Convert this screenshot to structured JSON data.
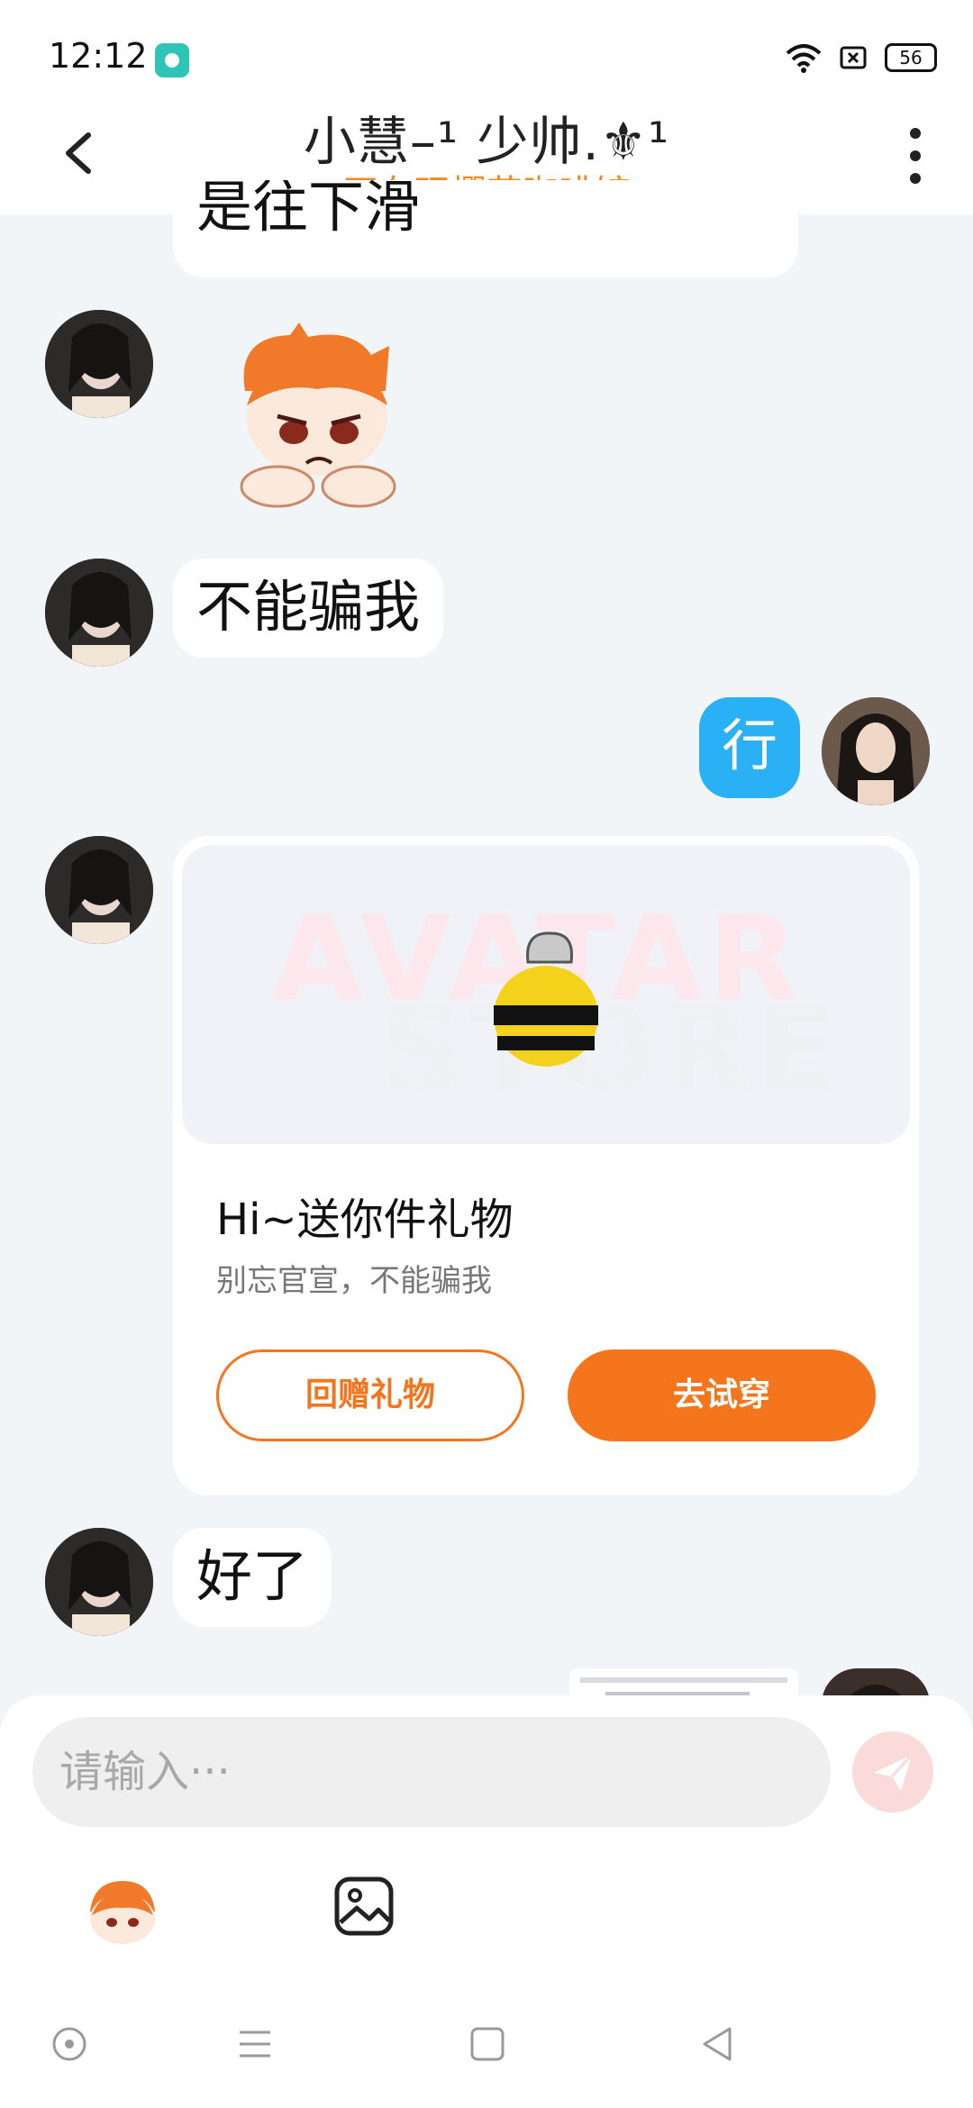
{
  "status_bar": {
    "time": "12:12",
    "battery": "56"
  },
  "header": {
    "title": "小慧–¹  少帅.⚜¹",
    "subtitle": "正在玩樱花咖啡馆"
  },
  "messages": {
    "top_partial": "是往下滑",
    "m1_text": "不能骗我",
    "m2_self": "行",
    "m4_text": "好了"
  },
  "gift_card": {
    "watermark_1": "AVATAR",
    "watermark_2": "STORE",
    "title": "Hi~送你件礼物",
    "desc": "别忘官宣，不能骗我",
    "return_gift_label": "回赠礼物",
    "try_on_label": "去试穿"
  },
  "input": {
    "placeholder": "请输入···"
  },
  "colors": {
    "accent": "#f5751d",
    "self_bubble": "#2ab0f5",
    "subtitle": "#f08a1e"
  },
  "icons": [
    "back-arrow-icon",
    "more-vertical-icon",
    "wifi-icon",
    "sim-icon",
    "battery-icon",
    "send-icon",
    "emoji-icon",
    "image-icon",
    "nav-home-icon",
    "nav-menu-icon",
    "nav-recent-icon",
    "nav-back-icon"
  ]
}
